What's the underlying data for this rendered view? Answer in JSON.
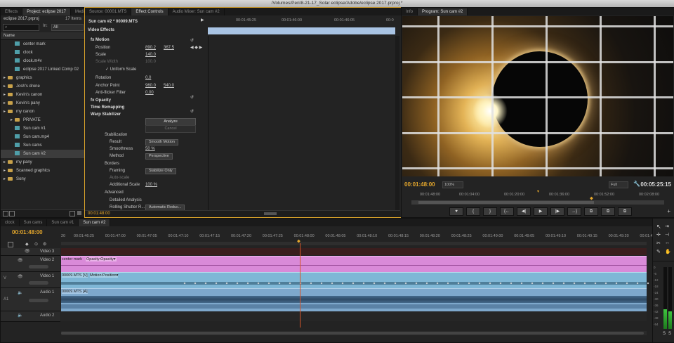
{
  "window_title": "/Volumes/Peri/8-21-17_Solar eclipse/Adobe/eclipse 2017.prproj *",
  "project_panel": {
    "tabs": [
      "Effects",
      "Project: eclipse 2017",
      "Media Br"
    ],
    "project_file": "eclipse 2017.prproj",
    "item_count": "17 Items",
    "in_label": "In:",
    "in_value": "All",
    "column_name": "Name",
    "items": [
      {
        "label": "center mark",
        "type": "clip",
        "indent": 1
      },
      {
        "label": "clock",
        "type": "clip",
        "indent": 1
      },
      {
        "label": "clock.m4v",
        "type": "clip",
        "indent": 1
      },
      {
        "label": "eclipse 2017 Linked Comp 02",
        "type": "clip",
        "indent": 1
      },
      {
        "label": "graphics",
        "type": "folder",
        "indent": 0
      },
      {
        "label": "Josh's drone",
        "type": "folder",
        "indent": 0
      },
      {
        "label": "Kevin's canon",
        "type": "folder",
        "indent": 0
      },
      {
        "label": "Kevin's pany",
        "type": "folder",
        "indent": 0
      },
      {
        "label": "my canon",
        "type": "folder",
        "indent": 0
      },
      {
        "label": "PRIVATE",
        "type": "folder",
        "indent": 1
      },
      {
        "label": "Sun cam #1",
        "type": "clip",
        "indent": 1
      },
      {
        "label": "Sun cam.mp4",
        "type": "clip",
        "indent": 1
      },
      {
        "label": "Sun cams",
        "type": "clip",
        "indent": 1
      },
      {
        "label": "Sun cam #2",
        "type": "clip",
        "indent": 1
      },
      {
        "label": "my pany",
        "type": "folder",
        "indent": 0
      },
      {
        "label": "Scanned graphics",
        "type": "folder",
        "indent": 0
      },
      {
        "label": "Sony",
        "type": "folder",
        "indent": 0
      }
    ]
  },
  "effect_controls": {
    "tabs": [
      "Source: 00001.MTS",
      "Effect Controls",
      "Audio Mixer: Sun cam #2"
    ],
    "clip_label": "Sun cam #2 * 00009.MTS",
    "ruler": [
      "00:01:45:25",
      "00:01:46:00",
      "00:01:46:05",
      "00:0"
    ],
    "video_effects_label": "Video Effects",
    "rows": [
      {
        "label": "fx  Motion",
        "bold": true,
        "indent": 0
      },
      {
        "label": "Position",
        "v1": "890.2",
        "v2": "367.5",
        "indent": 1
      },
      {
        "label": "Scale",
        "v1": "140.0",
        "v2": "",
        "indent": 1
      },
      {
        "label": "Scale Width",
        "v1": "100.0",
        "v2": "",
        "indent": 1,
        "dim": true
      },
      {
        "label": "✓ Uniform Scale",
        "v1": "",
        "v2": "",
        "indent": 3
      },
      {
        "label": "Rotation",
        "v1": "0.0",
        "v2": "",
        "indent": 1
      },
      {
        "label": "Anchor Point",
        "v1": "960.0",
        "v2": "540.0",
        "indent": 1
      },
      {
        "label": "Anti-flicker Filter",
        "v1": "0.00",
        "v2": "",
        "indent": 1
      },
      {
        "label": "fx  Opacity",
        "bold": true,
        "indent": 0
      },
      {
        "label": "Time Remapping",
        "bold": true,
        "indent": 0
      },
      {
        "label": "Warp Stabilizer",
        "bold": true,
        "indent": 0
      }
    ],
    "analyze_button": "Analyze",
    "cancel_button": "Cancel",
    "stabilization": {
      "section": "Stabilization",
      "result_label": "Result",
      "result_value": "Smooth Motion",
      "smoothness_label": "Smoothness",
      "smoothness_value": "50 %",
      "method_label": "Method",
      "method_value": "Perspective"
    },
    "borders": {
      "section": "Borders",
      "framing_label": "Framing",
      "framing_value": "Stabilize Only",
      "autoscale_label": "Auto-scale",
      "additional_scale_label": "Additional Scale",
      "additional_scale_value": "100 %"
    },
    "advanced": {
      "section": "Advanced",
      "detailed_label": "Detailed Analysis",
      "rolling_label": "Rolling Shutter R...",
      "rolling_value": "Automatic Reduc..."
    },
    "timecode": "00:01:48:00"
  },
  "program_monitor": {
    "tabs": [
      "Info",
      "Program: Sun cam #2"
    ],
    "current_time": "00:01:48:00",
    "zoom": "100%",
    "quality": "Full",
    "duration": "00:05:25:15",
    "ruler": [
      "00:01:48:00",
      "00:01:04:00",
      "00:01:20:00",
      "00:01:36:00",
      "00:01:52:00",
      "00:02:08:00"
    ],
    "transport": [
      "♥",
      "{",
      "}",
      "{←",
      "◀|",
      "▶",
      "|▶",
      "→}",
      "⧉",
      "⧉",
      "⧉"
    ]
  },
  "timeline": {
    "tabs": [
      "clock",
      "Sun cams",
      "Sun cam #1",
      "Sun cam #2"
    ],
    "timecode": "00:01:48:00",
    "ruler": [
      "20",
      "00:01:46:25",
      "00:01:47:00",
      "00:01:47:05",
      "00:01:47:10",
      "00:01:47:15",
      "00:01:47:20",
      "00:01:47:25",
      "00:01:48:00",
      "00:01:48:05",
      "00:01:48:10",
      "00:01:48:15",
      "00:01:48:20",
      "00:01:48:25",
      "00:01:49:00",
      "00:01:49:05",
      "00:01:49:10",
      "00:01:49:15",
      "00:01:49:20",
      "00:01:49:2"
    ],
    "tracks": {
      "video3": "Video 3",
      "video2": "Video 2",
      "video1": "Video 1",
      "audio1": "Audio 1",
      "audio2": "Audio 2",
      "v_label": "V",
      "a_label": "A1"
    },
    "clips": {
      "v2_name": "center mark",
      "v2_effect": "Opacity:Opacity▾",
      "v1_name": "00009.MTS [V]",
      "v1_effect": "Motion:Position▾",
      "a1_name": "00009.MTS [A]"
    },
    "meter_labels": [
      "0",
      "-6",
      "-12",
      "-18",
      "-24",
      "-30",
      "-36",
      "-42",
      "-48",
      "-54"
    ],
    "solo_labels": [
      "S",
      "S"
    ]
  },
  "colors": {
    "accent_timecode": "#e6a82c",
    "v2_clip": "#d98ad8",
    "v1_clip": "#7fb7d6",
    "a1_clip": "#7ea8cc",
    "playhead": "#d6562a"
  }
}
